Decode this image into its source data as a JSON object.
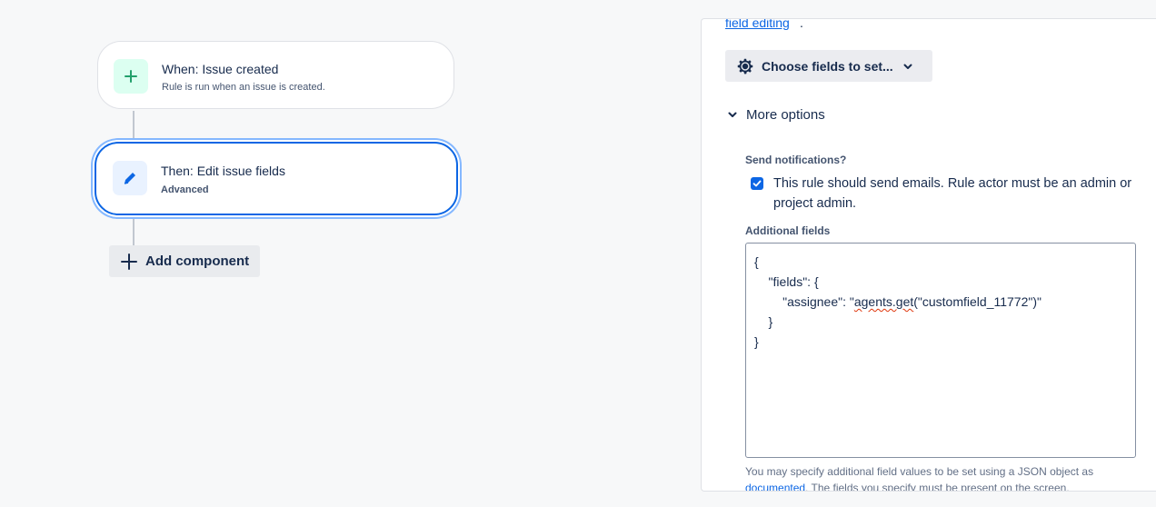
{
  "flow": {
    "trigger": {
      "title": "When: Issue created",
      "subtitle": "Rule is run when an issue is created.",
      "icon": "plus-icon",
      "color": "#22a06b"
    },
    "action": {
      "title": "Then: Edit issue fields",
      "subtitle": "Advanced",
      "icon": "pencil-icon",
      "color": "#0c66e4"
    },
    "add_component_label": "Add component"
  },
  "panel": {
    "top_link": "field editing",
    "top_period": ".",
    "choose_fields_label": "Choose fields to set...",
    "more_options_label": "More options",
    "send_notifications_label": "Send notifications?",
    "send_notifications_checked": true,
    "send_notifications_text": "This rule should send emails. Rule actor must be an admin or project admin.",
    "additional_fields_label": "Additional fields",
    "additional_fields_lines": [
      "{",
      "    \"fields\": {",
      "        \"assignee\": \"agents.get(\"customfield_11772\")\"",
      "    }",
      "}"
    ],
    "help_text_before": "You may specify additional field values to be set using a JSON object as ",
    "help_link": "documented",
    "help_text_after": ". The fields you specify must be present on the screen."
  },
  "colors": {
    "accent": "#0c66e4",
    "trigger_green": "#22a06b",
    "background": "#f7f8f9"
  }
}
